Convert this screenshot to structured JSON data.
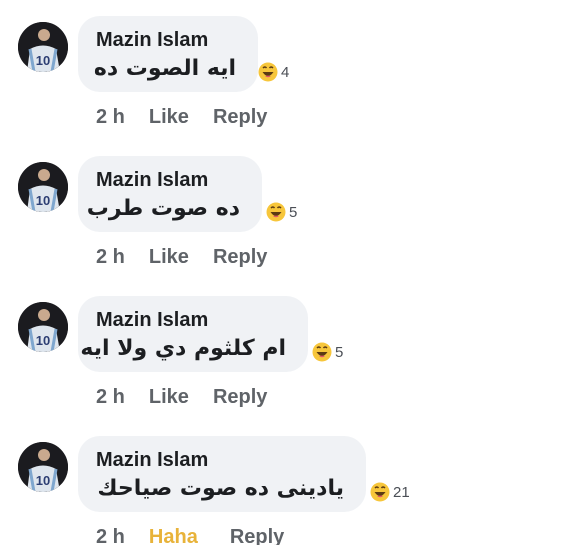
{
  "comments": [
    {
      "author": "Mazin Islam",
      "text": "ايه الصوت ده",
      "reaction_icon": "haha-icon",
      "reaction_count": "4",
      "time": "2 h",
      "like_label": "Like",
      "reply_label": "Reply"
    },
    {
      "author": "Mazin Islam",
      "text": "ده صوت طرب",
      "reaction_icon": "haha-icon",
      "reaction_count": "5",
      "time": "2 h",
      "like_label": "Like",
      "reply_label": "Reply"
    },
    {
      "author": "Mazin Islam",
      "text": "ام كلثوم دي ولا ايه",
      "reaction_icon": "haha-icon",
      "reaction_count": "5",
      "time": "2 h",
      "like_label": "Like",
      "reply_label": "Reply"
    },
    {
      "author": "Mazin Islam",
      "text": "يادينى ده صوت صياحك",
      "reaction_icon": "haha-icon",
      "reaction_count": "21",
      "time": "2 h",
      "like_label": "Haha",
      "like_active": true,
      "reply_label": "Reply"
    }
  ],
  "colors": {
    "bubble": "#f0f2f5",
    "action_text": "#5f6368",
    "haha_active": "#e8b33a",
    "jersey": "#dfe6ee"
  },
  "avatar": {
    "jersey_number": "10"
  }
}
